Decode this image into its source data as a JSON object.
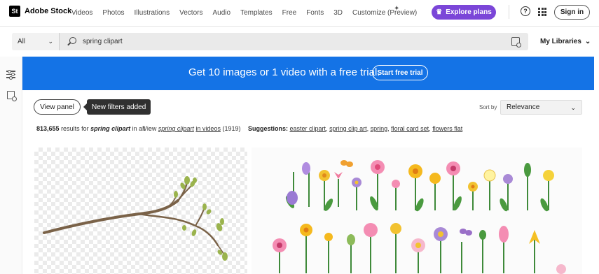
{
  "brand": {
    "badge": "St",
    "name": "Adobe Stock"
  },
  "nav": {
    "items": [
      "Videos",
      "Photos",
      "Illustrations",
      "Vectors",
      "Audio",
      "Templates",
      "Free",
      "Fonts",
      "3D",
      "Customize (Preview)"
    ]
  },
  "header": {
    "explore_label": "Explore plans",
    "help_glyph": "?",
    "signin_label": "Sign in"
  },
  "search": {
    "scope": "All",
    "query": "spring clipart",
    "libraries_label": "My Libraries"
  },
  "banner": {
    "text": "Get 10 images or 1 video with a free trial.",
    "button": "Start free trial"
  },
  "filters": {
    "view_panel": "View panel",
    "tooltip": "New filters added",
    "sort_label": "Sort by",
    "sort_value": "Relevance"
  },
  "results": {
    "count": "813,655",
    "results_for": "results for",
    "query": "spring clipart",
    "in_all": "in all",
    "view_prefix": "View",
    "video_link": "spring clipart",
    "video_suffix": "in videos",
    "video_count": "(1919)",
    "suggestions_label": "Suggestions:",
    "suggestions": [
      "easter clipart",
      "spring clip art",
      "spring",
      "floral card set",
      "flowers flat"
    ]
  },
  "colors": {
    "accent": "#1473e6",
    "explore": "#7b46d8",
    "tooltip": "#303030"
  },
  "icons": [
    "sparkle-icon",
    "crown-icon",
    "help-icon",
    "apps-grid-icon",
    "search-icon",
    "visual-search-icon",
    "filter-sliders-icon",
    "chevron-down-icon"
  ]
}
